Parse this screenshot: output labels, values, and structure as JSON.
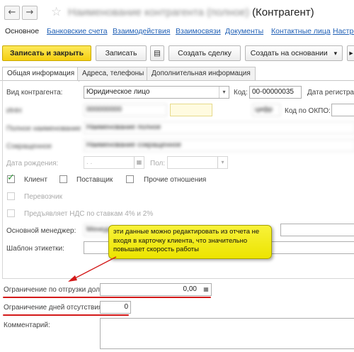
{
  "window": {
    "title_blurred": "Наименование контрагента (полное)",
    "title_suffix": "(Контрагент)"
  },
  "nav": {
    "back_glyph": "←",
    "forward_glyph": "→",
    "favorite_glyph": "☆",
    "tabs": [
      "Основное",
      "Банковские счета",
      "Взаимодействия",
      "Взаимосвязи",
      "Документы",
      "Контактные лица",
      "Настро"
    ]
  },
  "toolbar": {
    "save_close": "Записать и закрыть",
    "save": "Записать",
    "doc_icon_glyph": "▤",
    "create_deal": "Создать сделку",
    "create_based": "Создать на основании",
    "create_based_arrow": "▾",
    "more_glyph": "▸"
  },
  "form_tabs": [
    "Общая информация",
    "Адреса, телефоны",
    "Дополнительная информация"
  ],
  "form": {
    "kind_label": "Вид контрагента:",
    "kind_value": "Юридическое лицо",
    "dropdown_glyph": "▾",
    "code_label": "Код:",
    "code_value": "00-00000035",
    "reg_date_label": "Дата регистрац",
    "blurred_row1_label": "ИНН",
    "blurred_row1_value": "000000000",
    "blurred_btn": "цифр",
    "okpo_label": "Код по ОКПО:",
    "blurred_row2_label": "Полное наименование",
    "blurred_row2_value": "Наименование полное",
    "blurred_row3_label": "Сокращенное",
    "blurred_row3_value": "Наименование сокращенное",
    "birthdate_label": "Дата рождения:",
    "birthdate_value": " .  .",
    "calendar_glyph": "▦",
    "sex_label": "Пол:",
    "client_label": "Клиент",
    "client_check_glyph": "✓",
    "supplier_label": "Поставщик",
    "other_label": "Прочие отношения",
    "carrier_label": "Перевозчик",
    "vat_label": "Предъявляет НДС по ставкам 4% и 2%",
    "manager_label": "Основной менеджер:",
    "manager_value": "Менеджер Иванов",
    "label_template_label": "Шаблон этикетки:",
    "shipment_limit_label": "Ограничение по отгрузки долг:",
    "shipment_limit_value": "0,00",
    "absence_days_label": "Ограничение дней отсутствия:",
    "absence_days_value": "0",
    "comment_label": "Комментарий:"
  },
  "callout": {
    "text": "эти данные можно редактировать из отчета не входя в карточку клиента, что значительно повышает скорость работы"
  },
  "colors": {
    "accent_yellow": "#f5cf10",
    "link_blue": "#1f5fb5",
    "annotation_red": "#d31919",
    "callout_yellow": "#f8f23a"
  }
}
